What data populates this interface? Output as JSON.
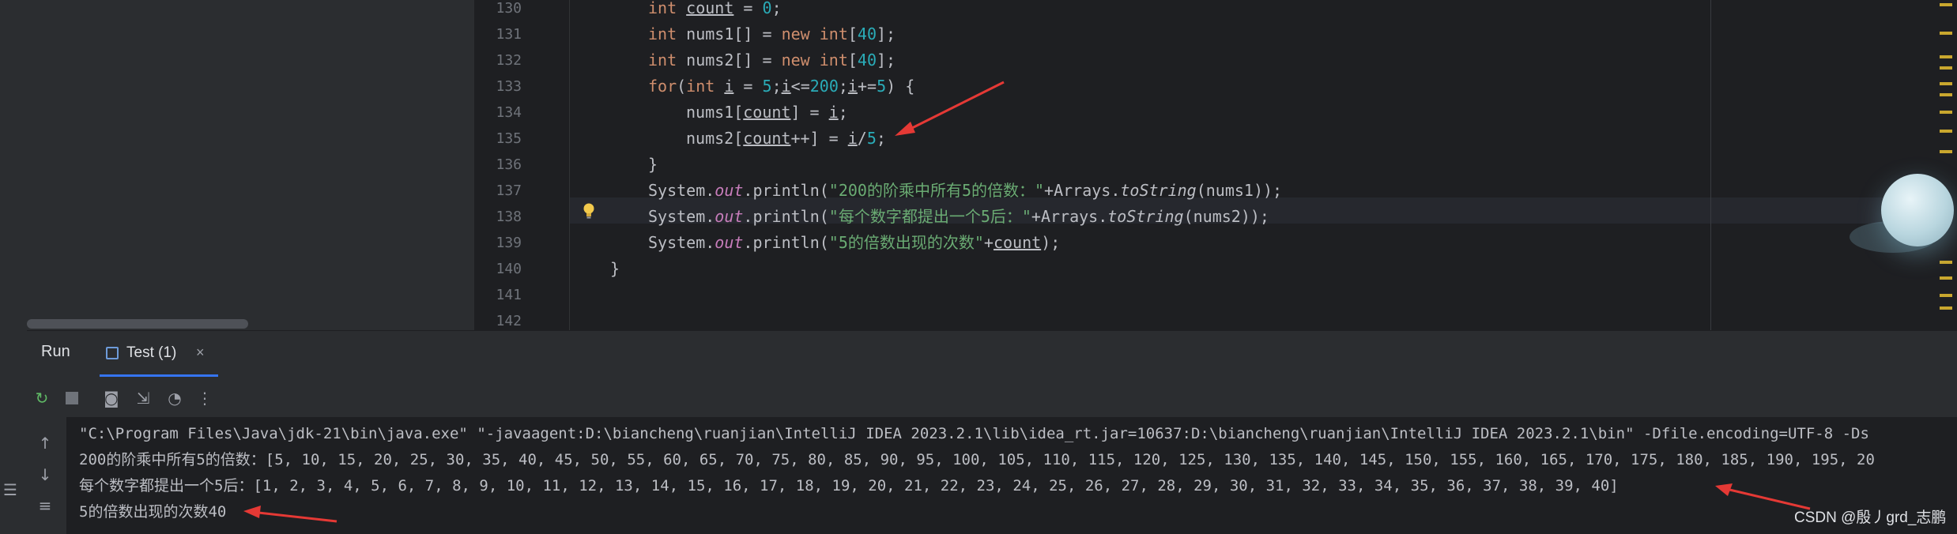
{
  "editor": {
    "lines": [
      {
        "no": "130",
        "segments": [
          {
            "t": "int",
            "c": "kw"
          },
          {
            "t": " "
          },
          {
            "t": "count",
            "c": "ul"
          },
          {
            "t": " = "
          },
          {
            "t": "0",
            "c": "num"
          },
          {
            "t": ";"
          }
        ]
      },
      {
        "no": "131",
        "segments": [
          {
            "t": "int",
            "c": "kw"
          },
          {
            "t": " nums1[] = "
          },
          {
            "t": "new",
            "c": "kw"
          },
          {
            "t": " "
          },
          {
            "t": "int",
            "c": "kw"
          },
          {
            "t": "["
          },
          {
            "t": "40",
            "c": "num"
          },
          {
            "t": "];"
          }
        ]
      },
      {
        "no": "132",
        "segments": [
          {
            "t": "int",
            "c": "kw"
          },
          {
            "t": " nums2[] = "
          },
          {
            "t": "new",
            "c": "kw"
          },
          {
            "t": " "
          },
          {
            "t": "int",
            "c": "kw"
          },
          {
            "t": "["
          },
          {
            "t": "40",
            "c": "num"
          },
          {
            "t": "];"
          }
        ]
      },
      {
        "no": "133",
        "segments": [
          {
            "t": "for",
            "c": "kw"
          },
          {
            "t": "("
          },
          {
            "t": "int",
            "c": "kw"
          },
          {
            "t": " "
          },
          {
            "t": "i",
            "c": "ul"
          },
          {
            "t": " = "
          },
          {
            "t": "5",
            "c": "num"
          },
          {
            "t": ";"
          },
          {
            "t": "i",
            "c": "ul"
          },
          {
            "t": "<="
          },
          {
            "t": "200",
            "c": "num"
          },
          {
            "t": ";"
          },
          {
            "t": "i",
            "c": "ul"
          },
          {
            "t": "+="
          },
          {
            "t": "5",
            "c": "num"
          },
          {
            "t": ") {"
          }
        ]
      },
      {
        "no": "134",
        "segments": [
          {
            "t": "nums1["
          },
          {
            "t": "count",
            "c": "ul"
          },
          {
            "t": "] = "
          },
          {
            "t": "i",
            "c": "ul"
          },
          {
            "t": ";"
          }
        ]
      },
      {
        "no": "135",
        "segments": [
          {
            "t": "nums2["
          },
          {
            "t": "count",
            "c": "ul"
          },
          {
            "t": "++] = "
          },
          {
            "t": "i",
            "c": "ul"
          },
          {
            "t": "/"
          },
          {
            "t": "5",
            "c": "num"
          },
          {
            "t": ";"
          }
        ]
      },
      {
        "no": "136",
        "segments": [
          {
            "t": "}"
          }
        ]
      },
      {
        "no": "137",
        "segments": [
          {
            "t": "System."
          },
          {
            "t": "out",
            "c": "fld"
          },
          {
            "t": ".println("
          },
          {
            "t": "\"200的阶乘中所有5的倍数：\"",
            "c": "str"
          },
          {
            "t": "+Arrays."
          },
          {
            "t": "toString",
            "c": "mth"
          },
          {
            "t": "(nums1));"
          }
        ]
      },
      {
        "no": "138",
        "segments": [
          {
            "t": "System."
          },
          {
            "t": "out",
            "c": "fld"
          },
          {
            "t": ".println("
          },
          {
            "t": "\"每个数字都提出一个5后：\"",
            "c": "str"
          },
          {
            "t": "+Arrays."
          },
          {
            "t": "toString",
            "c": "mth"
          },
          {
            "t": "(nums2));"
          }
        ]
      },
      {
        "no": "139",
        "segments": [
          {
            "t": "System."
          },
          {
            "t": "out",
            "c": "fld"
          },
          {
            "t": ".println("
          },
          {
            "t": "\"5的倍数出现的次数\"",
            "c": "str"
          },
          {
            "t": "+"
          },
          {
            "t": "count",
            "c": "ul"
          },
          {
            "t": ");"
          }
        ]
      },
      {
        "no": "140",
        "segments": [
          {
            "t": "}"
          }
        ]
      },
      {
        "no": "141",
        "segments": []
      },
      {
        "no": "142",
        "segments": []
      }
    ]
  },
  "run_panel": {
    "title": "Run",
    "tab_label": "Test (1)",
    "tab_close": "×"
  },
  "console": {
    "lines": [
      "\"C:\\Program Files\\Java\\jdk-21\\bin\\java.exe\" \"-javaagent:D:\\biancheng\\ruanjian\\IntelliJ IDEA 2023.2.1\\lib\\idea_rt.jar=10637:D:\\biancheng\\ruanjian\\IntelliJ IDEA 2023.2.1\\bin\" -Dfile.encoding=UTF-8 -Ds",
      "200的阶乘中所有5的倍数：[5, 10, 15, 20, 25, 30, 35, 40, 45, 50, 55, 60, 65, 70, 75, 80, 85, 90, 95, 100, 105, 110, 115, 120, 125, 130, 135, 140, 145, 150, 155, 160, 165, 170, 175, 180, 185, 190, 195, 20",
      "每个数字都提出一个5后：[1, 2, 3, 4, 5, 6, 7, 8, 9, 10, 11, 12, 13, 14, 15, 16, 17, 18, 19, 20, 21, 22, 23, 24, 25, 26, 27, 28, 29, 30, 31, 32, 33, 34, 35, 36, 37, 38, 39, 40]",
      "5的倍数出现的次数40"
    ]
  },
  "watermark": "CSDN @殷丿grd_志鹏",
  "colors": {
    "annotation_arrow": "#e53935",
    "accent": "#3574f0"
  }
}
